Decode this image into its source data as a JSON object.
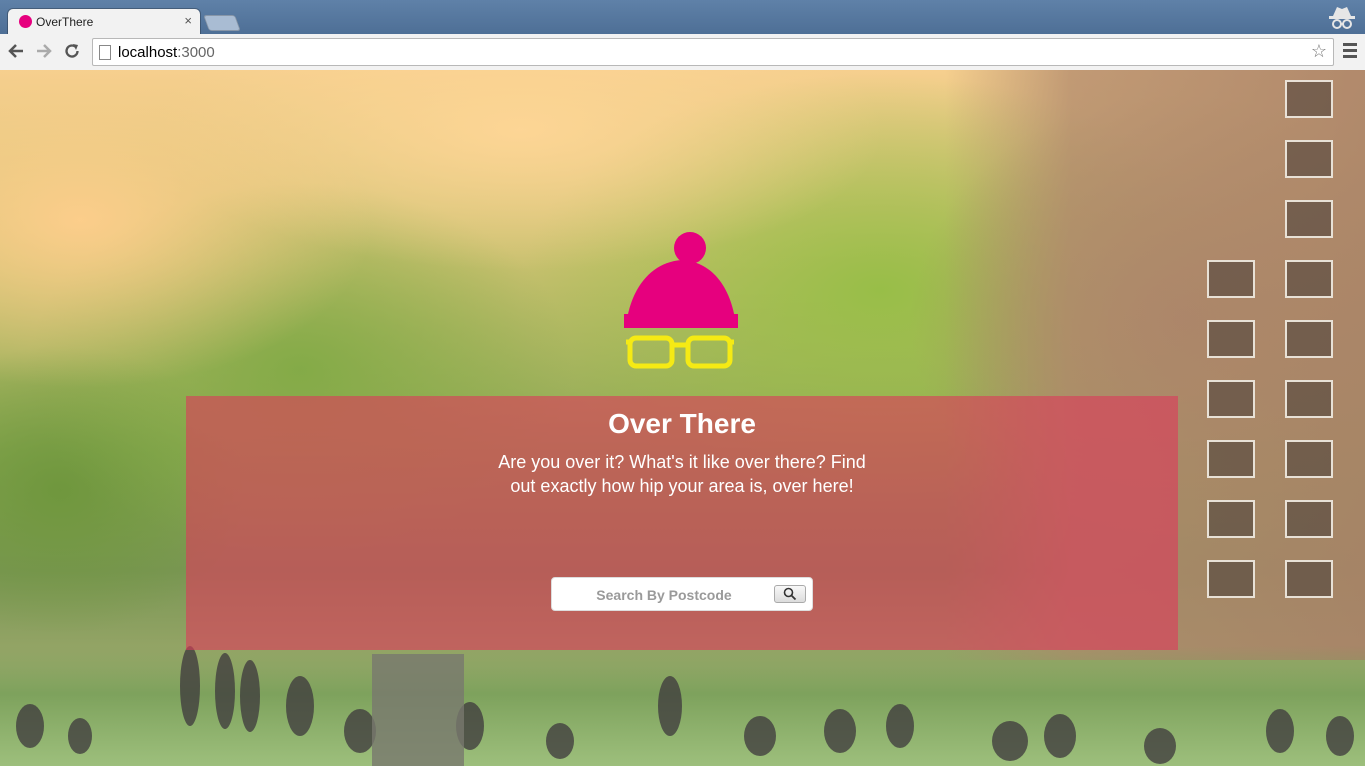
{
  "browser": {
    "tab": {
      "title": "OverThere",
      "close_label": "×"
    },
    "nav": {
      "back_icon": "back-arrow-icon",
      "forward_icon": "forward-arrow-icon",
      "reload_icon": "reload-icon"
    },
    "address": {
      "host": "localhost",
      "port": ":3000"
    },
    "icons": [
      "page-icon",
      "star-icon",
      "menu-icon",
      "incognito-icon"
    ]
  },
  "page": {
    "title": "Over There",
    "tagline": "Are you over it? What's it like over there? Find out exactly how hip your area is, over here!",
    "search": {
      "placeholder": "Search By Postcode",
      "value": "",
      "button_icon": "search-icon"
    },
    "logo": {
      "icon": "beanie-glasses-logo",
      "hat_color": "#e6007e",
      "glasses_color": "#f5ea14"
    }
  },
  "colors": {
    "panel": "#dc3c5a",
    "chrome": "#5f81a8"
  }
}
